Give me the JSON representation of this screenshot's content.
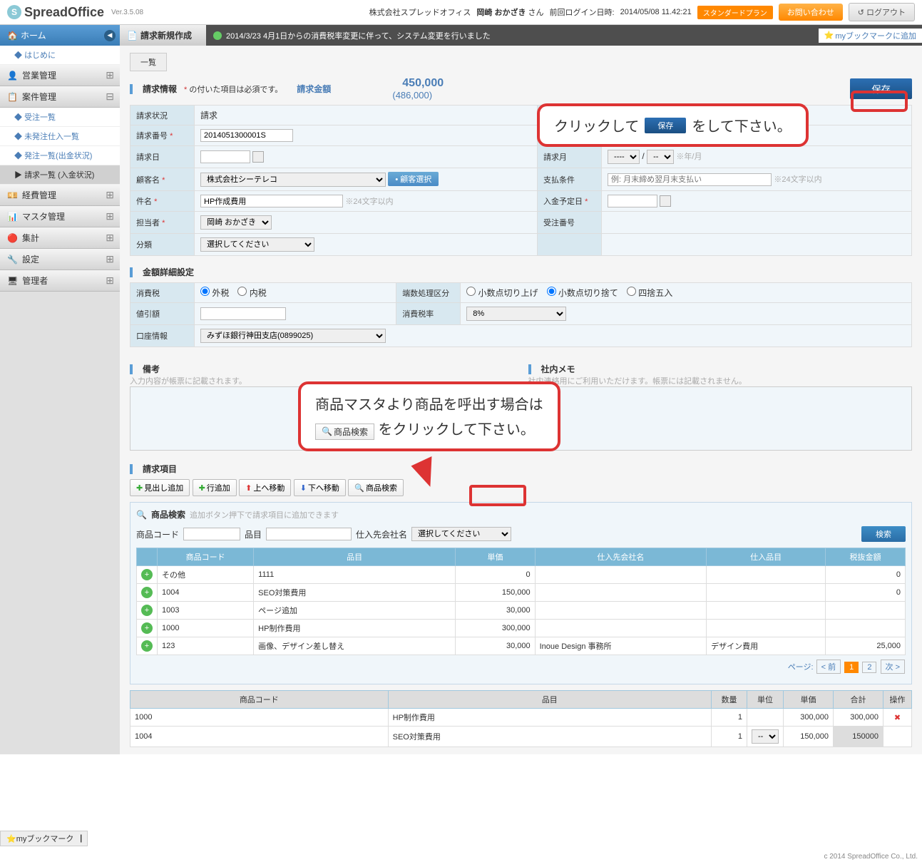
{
  "app": {
    "name": "SpreadOffice",
    "version": "Ver.3.5.08"
  },
  "header": {
    "company": "株式会社スプレッドオフィス",
    "user": "岡崎 おかざき",
    "user_suffix": "さん",
    "last_login_label": "前回ログイン日時:",
    "last_login": "2014/05/08 11.42:21",
    "plan": "スタンダードプラン",
    "contact": "お問い合わせ",
    "logout": "ログアウト"
  },
  "sidebar": {
    "home": "ホーム",
    "intro": "はじめに",
    "cats": {
      "sales": "営業管理",
      "anken": "案件管理",
      "expense": "経費管理",
      "master": "マスタ管理",
      "aggregate": "集計",
      "settings": "設定",
      "admin": "管理者"
    },
    "subs": {
      "order_list": "受注一覧",
      "unissued_purchase": "未発注仕入一覧",
      "issue_list": "発注一覧(出金状況)",
      "invoice_list": "請求一覧 (入金状況)"
    }
  },
  "page_title": "請求新規作成",
  "news": "2014/3/23 4月1日からの消費税率変更に伴って、システム変更を行いました",
  "bookmark_add": "myブックマークに追加",
  "tabs": {
    "list": "一覧"
  },
  "info": {
    "title": "請求情報",
    "required_note": "の付いた項目は必須です。",
    "required_mark": "*",
    "amount_label": "請求金額",
    "amount": "450,000",
    "amount_tax": "(486,000)",
    "save": "保存"
  },
  "form": {
    "status_label": "請求状況",
    "status_val": "請求",
    "no_label": "請求番号",
    "no_val": "2014051300001S",
    "date_label": "請求日",
    "bill_month_label": "請求月",
    "bill_month_sel1": "----",
    "bill_month_sel2": "--",
    "bill_month_note": "※年/月",
    "customer_label": "顧客名",
    "customer_val": "株式会社シーテレコ",
    "customer_btn": "顧客選択",
    "pay_terms_label": "支払条件",
    "pay_terms_ph": "例: 月末締め翌月末支払い",
    "pay_terms_note": "※24文字以内",
    "subject_label": "件名",
    "subject_val": "HP作成費用",
    "subject_note": "※24文字以内",
    "payment_due_label": "入金予定日",
    "pic_label": "担当者",
    "pic_val": "岡崎 おかざき",
    "order_no_label": "受注番号",
    "category_label": "分類",
    "category_val": "選択してください"
  },
  "amount_detail": {
    "title": "金額詳細設定",
    "tax_label": "消費税",
    "tax_opt1": "外税",
    "tax_opt2": "内税",
    "rounding_label": "端数処理区分",
    "round_opt1": "小数点切り上げ",
    "round_opt2": "小数点切り捨て",
    "round_opt3": "四捨五入",
    "discount_label": "値引額",
    "tax_rate_label": "消費税率",
    "tax_rate_val": "8%",
    "account_label": "口座情報",
    "account_val": "みずほ銀行神田支店(0899025)"
  },
  "remarks": {
    "title1": "備考",
    "note1": "入力内容が帳票に記載されます。",
    "title2": "社内メモ",
    "note2": "社内連絡用にご利用いただけます。帳票には記載されません。"
  },
  "line_items": {
    "title": "請求項目",
    "btn_heading": "見出し追加",
    "btn_row": "行追加",
    "btn_up": "上へ移動",
    "btn_down": "下へ移動",
    "btn_search": "商品検索"
  },
  "search": {
    "title": "商品検索",
    "hint": "追加ボタン押下で請求項目に追加できます",
    "code_label": "商品コード",
    "item_label": "品目",
    "vendor_label": "仕入先会社名",
    "vendor_val": "選択してください",
    "search_btn": "検索",
    "cols": {
      "code": "商品コード",
      "item": "品目",
      "price": "単価",
      "vendor": "仕入先会社名",
      "vendor_item": "仕入品目",
      "tax_excl": "税抜金額"
    },
    "rows": [
      {
        "code": "その他",
        "item": "1111",
        "price": "0",
        "vendor": "",
        "vitem": "",
        "tax": "0"
      },
      {
        "code": "1004",
        "item": "SEO対策費用",
        "price": "150,000",
        "vendor": "",
        "vitem": "",
        "tax": "0"
      },
      {
        "code": "1003",
        "item": "ページ追加",
        "price": "30,000",
        "vendor": "",
        "vitem": "",
        "tax": ""
      },
      {
        "code": "1000",
        "item": "HP制作費用",
        "price": "300,000",
        "vendor": "",
        "vitem": "",
        "tax": ""
      },
      {
        "code": "123",
        "item": "画像、デザイン差し替え",
        "price": "30,000",
        "vendor": "Inoue Design 事務所",
        "vitem": "デザイン費用",
        "tax": "25,000"
      }
    ],
    "pager": {
      "label": "ページ:",
      "prev": "< 前",
      "p1": "1",
      "p2": "2",
      "next": "次 >"
    }
  },
  "selected": {
    "cols": {
      "code": "商品コード",
      "item": "品目",
      "qty": "数量",
      "unit": "単位",
      "price": "単価",
      "total": "合計",
      "op": "操作"
    },
    "rows": [
      {
        "code": "1000",
        "item": "HP制作費用",
        "qty": "1",
        "unit": "",
        "price": "300,000",
        "total": "300,000"
      },
      {
        "code": "1004",
        "item": "SEO対策費用",
        "qty": "1",
        "unit": "--",
        "price": "150,000",
        "total": "150000"
      }
    ]
  },
  "callouts": {
    "save_pre": "クリックして",
    "save_btn": "保存",
    "save_post": "をして下さい。",
    "search_pre": "商品マスタより商品を呼出す場合は",
    "search_btn": "商品検索",
    "search_post": "をクリックして下さい。"
  },
  "footer": {
    "bookmark": "myブックマーク▕",
    "copy": "c 2014 SpreadOffice Co., Ltd."
  }
}
